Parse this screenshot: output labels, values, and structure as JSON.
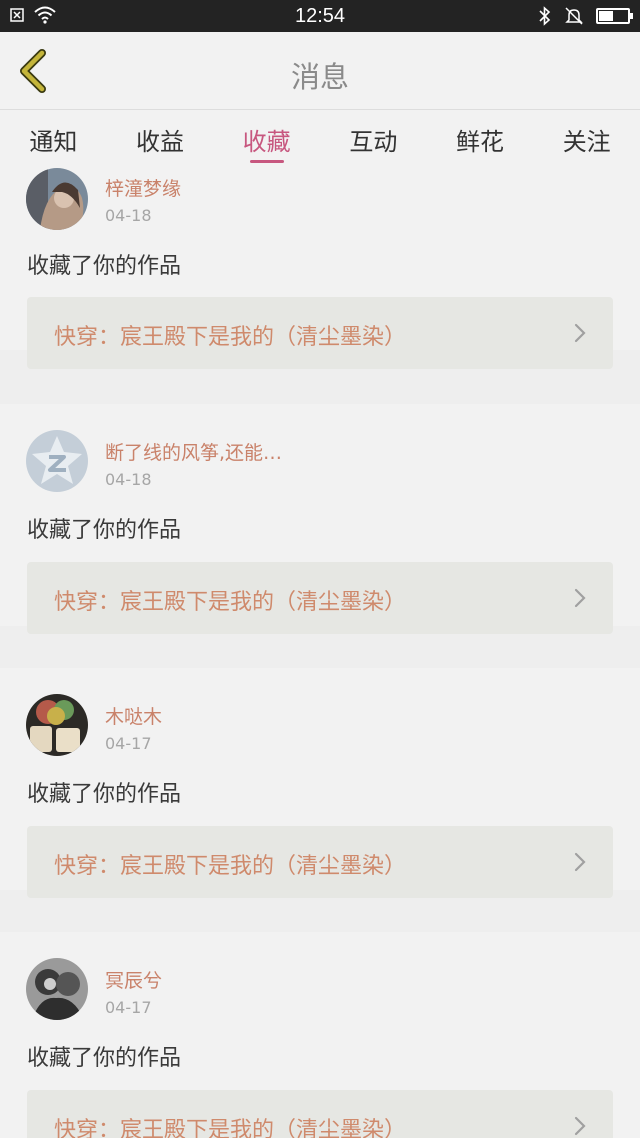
{
  "status_bar": {
    "time": "12:54",
    "icons_left": [
      "close-box-icon",
      "wifi-icon"
    ],
    "icons_right": [
      "bluetooth-icon",
      "bell-muted-icon",
      "battery-icon"
    ],
    "battery_level": 0.5
  },
  "header": {
    "title": "消息",
    "back_icon": "chevron-left-icon"
  },
  "tabs": [
    {
      "label": "通知",
      "active": false
    },
    {
      "label": "收益",
      "active": false
    },
    {
      "label": "收藏",
      "active": true
    },
    {
      "label": "互动",
      "active": false
    },
    {
      "label": "鲜花",
      "active": false
    },
    {
      "label": "关注",
      "active": false
    }
  ],
  "notifications": [
    {
      "username": "梓潼梦缘",
      "date": "04-18",
      "message": "收藏了你的作品",
      "work_title": "快穿：宸王殿下是我的（清尘墨染）"
    },
    {
      "username": "断了线的风筝,还能…",
      "date": "04-18",
      "message": "收藏了你的作品",
      "work_title": "快穿：宸王殿下是我的（清尘墨染）"
    },
    {
      "username": "木哒木",
      "date": "04-17",
      "message": "收藏了你的作品",
      "work_title": "快穿：宸王殿下是我的（清尘墨染）"
    },
    {
      "username": "冥辰兮",
      "date": "04-17",
      "message": "收藏了你的作品",
      "work_title": "快穿：宸王殿下是我的（清尘墨染）"
    }
  ],
  "colors": {
    "accent": "#c7577f",
    "username": "#c9826a",
    "work_title": "#cf8a6c",
    "status_bar": "#232323"
  }
}
